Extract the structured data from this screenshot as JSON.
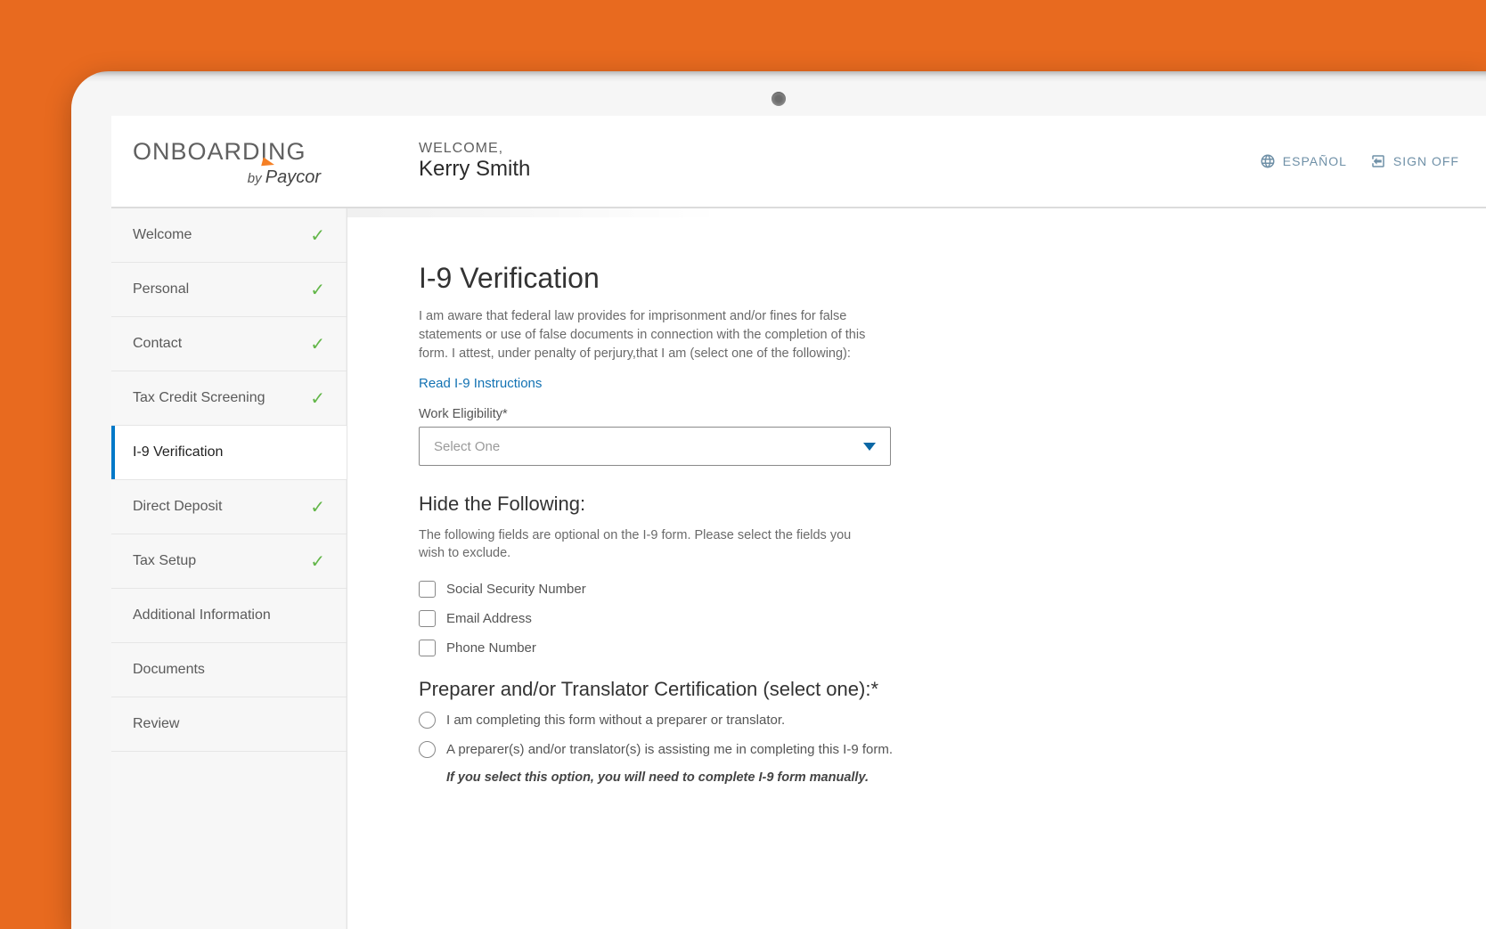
{
  "logo": {
    "title": "ONBOARDING",
    "by": "by",
    "brand": "Paycor"
  },
  "header": {
    "welcome_label": "WELCOME,",
    "user_name": "Kerry Smith",
    "espanol": "ESPAÑOL",
    "signoff": "SIGN OFF"
  },
  "sidebar": {
    "items": [
      {
        "label": "Welcome",
        "done": true,
        "active": false
      },
      {
        "label": "Personal",
        "done": true,
        "active": false
      },
      {
        "label": "Contact",
        "done": true,
        "active": false
      },
      {
        "label": "Tax Credit Screening",
        "done": true,
        "active": false
      },
      {
        "label": "I-9 Verification",
        "done": false,
        "active": true
      },
      {
        "label": "Direct Deposit",
        "done": true,
        "active": false
      },
      {
        "label": "Tax Setup",
        "done": true,
        "active": false
      },
      {
        "label": "Additional Information",
        "done": false,
        "active": false
      },
      {
        "label": "Documents",
        "done": false,
        "active": false
      },
      {
        "label": "Review",
        "done": false,
        "active": false
      }
    ]
  },
  "page": {
    "title": "I-9 Verification",
    "intro": "I am aware that federal law provides for imprisonment and/or fines for false statements or use of false documents in connection with the completion of this form. I attest, under penalty of perjury,that I am (select one of the following):",
    "instructions_link": "Read I-9 Instructions",
    "work_elig_label": "Work Eligibility*",
    "work_elig_placeholder": "Select One",
    "hide_title": "Hide the Following:",
    "hide_sub": "The following fields are optional on the I-9 form. Please select the fields you wish to exclude.",
    "hide_options": [
      "Social Security Number",
      "Email Address",
      "Phone Number"
    ],
    "preparer_title": "Preparer and/or Translator Certification (select one):*",
    "preparer_options": [
      "I am completing this form without a preparer or translator.",
      "A preparer(s) and/or translator(s) is assisting me in completing this I-9 form."
    ],
    "preparer_note": "If you select this option, you will need to complete I-9 form manually."
  }
}
